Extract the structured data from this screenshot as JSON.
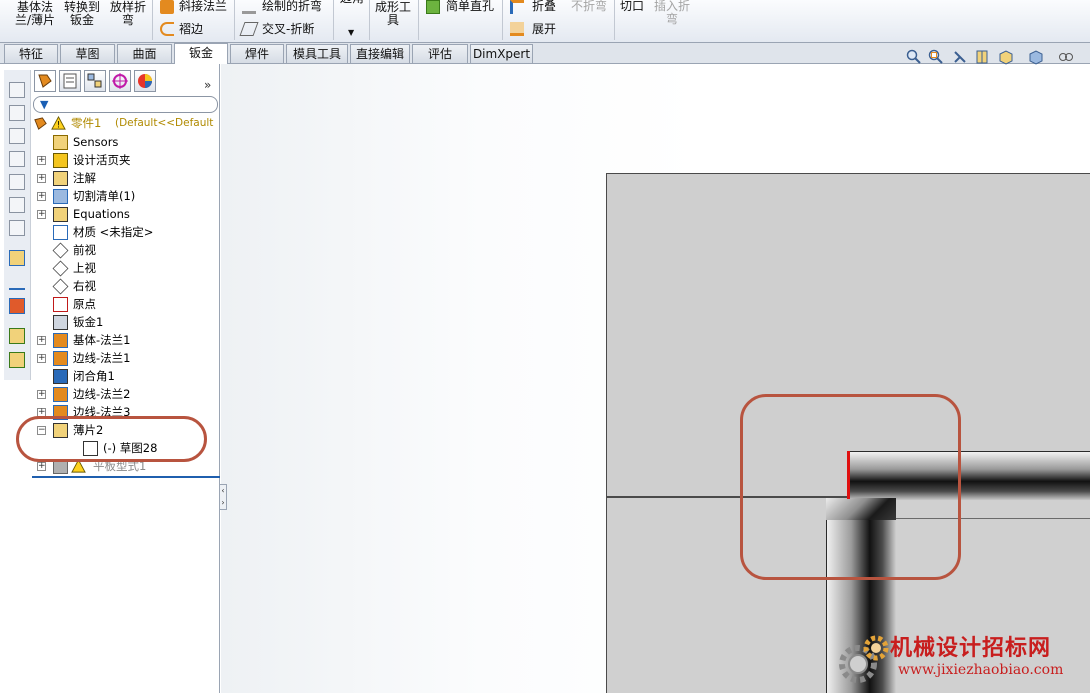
{
  "ribbon": {
    "items": [
      {
        "label": "基体法\n兰/薄片",
        "disabled": false
      },
      {
        "label": "转换到\n钣金",
        "disabled": false
      },
      {
        "label": "放样折\n弯",
        "disabled": false
      },
      {
        "label": "斜接法兰",
        "disabled": false
      },
      {
        "label": "褶边",
        "disabled": false
      },
      {
        "label": "绘制的折弯",
        "disabled": false
      },
      {
        "label": "交叉-折断",
        "disabled": false
      },
      {
        "label": "边角",
        "disabled": false
      },
      {
        "label": "成形工\n具",
        "disabled": false
      },
      {
        "label": "简单直孔",
        "disabled": false
      },
      {
        "label": "折叠",
        "disabled": false
      },
      {
        "label": "展开",
        "disabled": false
      },
      {
        "label": "不折弯",
        "disabled": true
      },
      {
        "label": "切口",
        "disabled": false
      },
      {
        "label": "插入折\n弯",
        "disabled": true
      }
    ]
  },
  "tabs": [
    {
      "label": "特征",
      "active": false
    },
    {
      "label": "草图",
      "active": false
    },
    {
      "label": "曲面",
      "active": false
    },
    {
      "label": "钣金",
      "active": true
    },
    {
      "label": "焊件",
      "active": false
    },
    {
      "label": "模具工具",
      "active": false
    },
    {
      "label": "直接编辑",
      "active": false
    },
    {
      "label": "评估",
      "active": false
    },
    {
      "label": "DimXpert",
      "active": false
    }
  ],
  "view_toolbar": {
    "icons": [
      "zoom-to-fit-icon",
      "zoom-area-icon",
      "previous-view-icon",
      "section-view-icon",
      "view-orientation-icon",
      "display-style-icon",
      "hide-show-icon"
    ]
  },
  "feature_manager": {
    "overflow_glyph": "»",
    "filter_glyph": "▼",
    "root": {
      "label": "零件1",
      "config": "(Default<<Default"
    },
    "items": [
      {
        "label": "Sensors",
        "expand": false
      },
      {
        "label": "设计活页夹",
        "expand": true
      },
      {
        "label": "注解",
        "expand": true
      },
      {
        "label": "切割清单(1)",
        "expand": true
      },
      {
        "label": "Equations",
        "expand": true
      },
      {
        "label": "材质 <未指定>",
        "expand": false
      },
      {
        "label": "前视",
        "expand": false
      },
      {
        "label": "上视",
        "expand": false
      },
      {
        "label": "右视",
        "expand": false
      },
      {
        "label": "原点",
        "expand": false
      },
      {
        "label": "钣金1",
        "expand": false
      },
      {
        "label": "基体-法兰1",
        "expand": true
      },
      {
        "label": "边线-法兰1",
        "expand": true
      },
      {
        "label": "闭合角1",
        "expand": false
      },
      {
        "label": "边线-法兰2",
        "expand": true
      },
      {
        "label": "边线-法兰3",
        "expand": true
      },
      {
        "label": "薄片2",
        "expand": "open"
      },
      {
        "label": "(-) 草图28",
        "expand": false
      },
      {
        "label": "平板型式1",
        "expand": true
      }
    ]
  },
  "watermark": {
    "title": "机械设计招标网",
    "url": "www.jixiezhaobiao.com"
  },
  "colors": {
    "callout": "#b8543f",
    "red_edge": "#e01010",
    "watermark": "#c81e1e"
  }
}
